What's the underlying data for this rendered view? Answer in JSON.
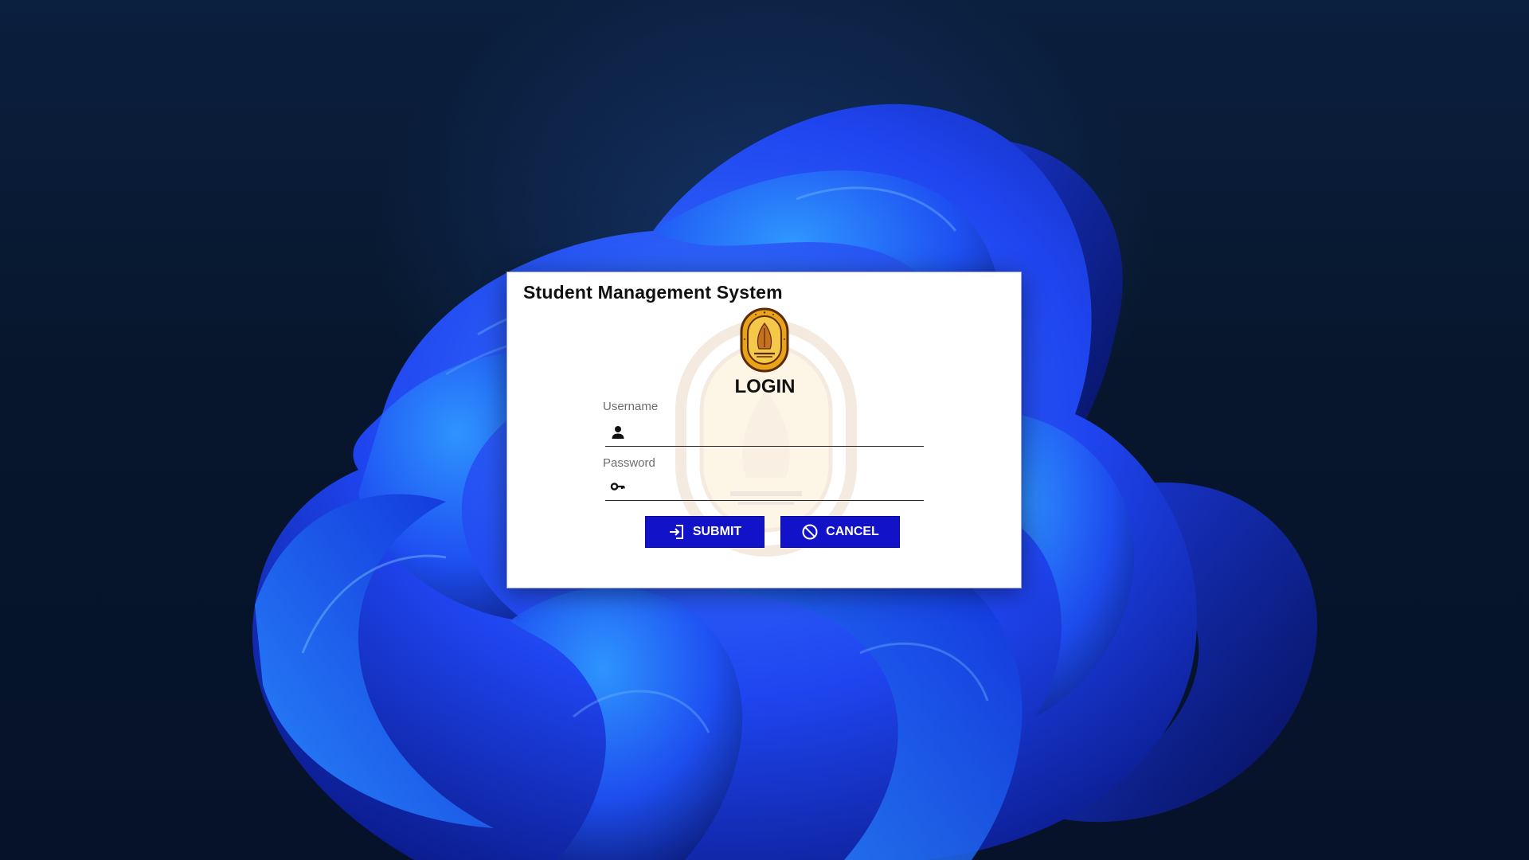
{
  "window": {
    "title": "Student Management System"
  },
  "login": {
    "heading": "LOGIN",
    "username_label": "Username",
    "username_value": "",
    "password_label": "Password",
    "password_value": ""
  },
  "buttons": {
    "submit_label": "SUBMIT",
    "cancel_label": "CANCEL"
  },
  "icons": {
    "username": "user-icon",
    "password": "key-icon",
    "submit": "login-arrow-icon",
    "cancel": "prohibited-icon"
  },
  "colors": {
    "button_bg": "#1212c8",
    "window_bg": "#ffffff",
    "desktop_bg": "#07162c",
    "accent_blue": "#1a3cff",
    "logo_gold": "#e8a317",
    "logo_dark": "#5a2a0a"
  }
}
